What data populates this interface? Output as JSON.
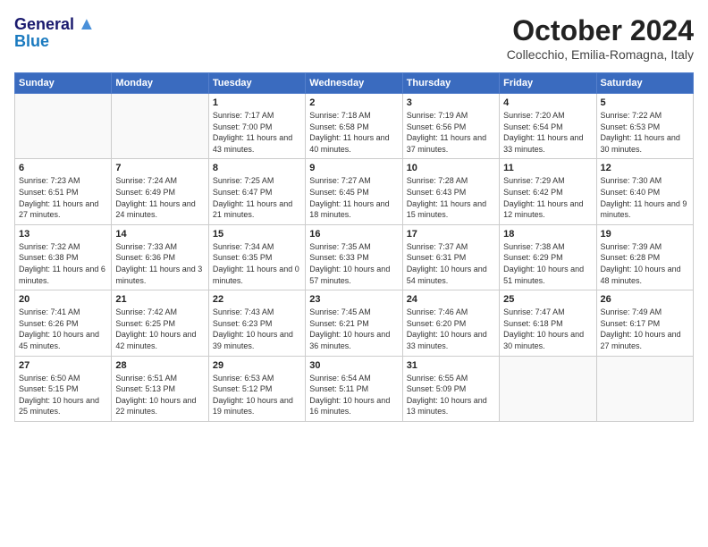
{
  "header": {
    "logo_line1": "General",
    "logo_line2": "Blue",
    "month_title": "October 2024",
    "location": "Collecchio, Emilia-Romagna, Italy"
  },
  "weekdays": [
    "Sunday",
    "Monday",
    "Tuesday",
    "Wednesday",
    "Thursday",
    "Friday",
    "Saturday"
  ],
  "weeks": [
    [
      {
        "day": "",
        "info": ""
      },
      {
        "day": "",
        "info": ""
      },
      {
        "day": "1",
        "info": "Sunrise: 7:17 AM\nSunset: 7:00 PM\nDaylight: 11 hours and 43 minutes."
      },
      {
        "day": "2",
        "info": "Sunrise: 7:18 AM\nSunset: 6:58 PM\nDaylight: 11 hours and 40 minutes."
      },
      {
        "day": "3",
        "info": "Sunrise: 7:19 AM\nSunset: 6:56 PM\nDaylight: 11 hours and 37 minutes."
      },
      {
        "day": "4",
        "info": "Sunrise: 7:20 AM\nSunset: 6:54 PM\nDaylight: 11 hours and 33 minutes."
      },
      {
        "day": "5",
        "info": "Sunrise: 7:22 AM\nSunset: 6:53 PM\nDaylight: 11 hours and 30 minutes."
      }
    ],
    [
      {
        "day": "6",
        "info": "Sunrise: 7:23 AM\nSunset: 6:51 PM\nDaylight: 11 hours and 27 minutes."
      },
      {
        "day": "7",
        "info": "Sunrise: 7:24 AM\nSunset: 6:49 PM\nDaylight: 11 hours and 24 minutes."
      },
      {
        "day": "8",
        "info": "Sunrise: 7:25 AM\nSunset: 6:47 PM\nDaylight: 11 hours and 21 minutes."
      },
      {
        "day": "9",
        "info": "Sunrise: 7:27 AM\nSunset: 6:45 PM\nDaylight: 11 hours and 18 minutes."
      },
      {
        "day": "10",
        "info": "Sunrise: 7:28 AM\nSunset: 6:43 PM\nDaylight: 11 hours and 15 minutes."
      },
      {
        "day": "11",
        "info": "Sunrise: 7:29 AM\nSunset: 6:42 PM\nDaylight: 11 hours and 12 minutes."
      },
      {
        "day": "12",
        "info": "Sunrise: 7:30 AM\nSunset: 6:40 PM\nDaylight: 11 hours and 9 minutes."
      }
    ],
    [
      {
        "day": "13",
        "info": "Sunrise: 7:32 AM\nSunset: 6:38 PM\nDaylight: 11 hours and 6 minutes."
      },
      {
        "day": "14",
        "info": "Sunrise: 7:33 AM\nSunset: 6:36 PM\nDaylight: 11 hours and 3 minutes."
      },
      {
        "day": "15",
        "info": "Sunrise: 7:34 AM\nSunset: 6:35 PM\nDaylight: 11 hours and 0 minutes."
      },
      {
        "day": "16",
        "info": "Sunrise: 7:35 AM\nSunset: 6:33 PM\nDaylight: 10 hours and 57 minutes."
      },
      {
        "day": "17",
        "info": "Sunrise: 7:37 AM\nSunset: 6:31 PM\nDaylight: 10 hours and 54 minutes."
      },
      {
        "day": "18",
        "info": "Sunrise: 7:38 AM\nSunset: 6:29 PM\nDaylight: 10 hours and 51 minutes."
      },
      {
        "day": "19",
        "info": "Sunrise: 7:39 AM\nSunset: 6:28 PM\nDaylight: 10 hours and 48 minutes."
      }
    ],
    [
      {
        "day": "20",
        "info": "Sunrise: 7:41 AM\nSunset: 6:26 PM\nDaylight: 10 hours and 45 minutes."
      },
      {
        "day": "21",
        "info": "Sunrise: 7:42 AM\nSunset: 6:25 PM\nDaylight: 10 hours and 42 minutes."
      },
      {
        "day": "22",
        "info": "Sunrise: 7:43 AM\nSunset: 6:23 PM\nDaylight: 10 hours and 39 minutes."
      },
      {
        "day": "23",
        "info": "Sunrise: 7:45 AM\nSunset: 6:21 PM\nDaylight: 10 hours and 36 minutes."
      },
      {
        "day": "24",
        "info": "Sunrise: 7:46 AM\nSunset: 6:20 PM\nDaylight: 10 hours and 33 minutes."
      },
      {
        "day": "25",
        "info": "Sunrise: 7:47 AM\nSunset: 6:18 PM\nDaylight: 10 hours and 30 minutes."
      },
      {
        "day": "26",
        "info": "Sunrise: 7:49 AM\nSunset: 6:17 PM\nDaylight: 10 hours and 27 minutes."
      }
    ],
    [
      {
        "day": "27",
        "info": "Sunrise: 6:50 AM\nSunset: 5:15 PM\nDaylight: 10 hours and 25 minutes."
      },
      {
        "day": "28",
        "info": "Sunrise: 6:51 AM\nSunset: 5:13 PM\nDaylight: 10 hours and 22 minutes."
      },
      {
        "day": "29",
        "info": "Sunrise: 6:53 AM\nSunset: 5:12 PM\nDaylight: 10 hours and 19 minutes."
      },
      {
        "day": "30",
        "info": "Sunrise: 6:54 AM\nSunset: 5:11 PM\nDaylight: 10 hours and 16 minutes."
      },
      {
        "day": "31",
        "info": "Sunrise: 6:55 AM\nSunset: 5:09 PM\nDaylight: 10 hours and 13 minutes."
      },
      {
        "day": "",
        "info": ""
      },
      {
        "day": "",
        "info": ""
      }
    ]
  ]
}
